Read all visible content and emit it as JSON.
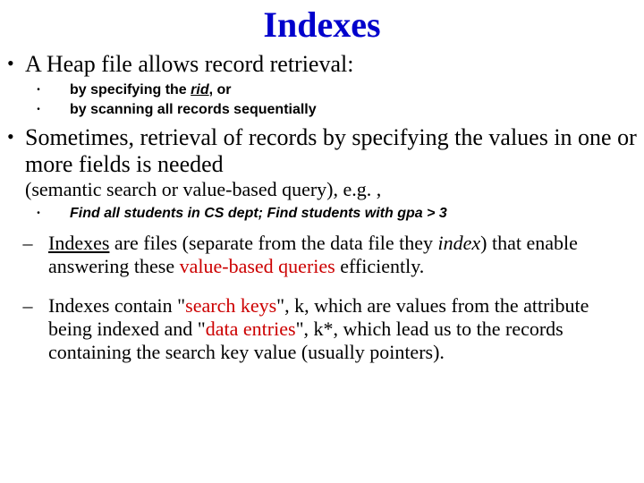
{
  "title": "Indexes",
  "b1": {
    "main": "A Heap file allows record retrieval:",
    "s1a": "by specifying the ",
    "s1b": "rid",
    "s1c": ", or",
    "s2": "by scanning all records sequentially"
  },
  "b2": {
    "main": "Sometimes, retrieval of records by specifying the values in one or more fields is needed",
    "note": "(semantic search or value-based query), e.g. ,",
    "s1": "Find all students in CS dept; Find students with gpa > 3"
  },
  "d1": {
    "a": "Indexes",
    "b": " are files (separate from the data file they ",
    "c": "index",
    "d": ") that enable answering these ",
    "e": "value-based queries",
    "f": " efficiently."
  },
  "d2": {
    "a": "Indexes contain \"",
    "b": "search keys",
    "c": "\", k, which are values from the attribute being indexed and \"",
    "d": "data entries",
    "e": "\", k*, which lead us to the records containing the search key value (usually pointers)."
  }
}
